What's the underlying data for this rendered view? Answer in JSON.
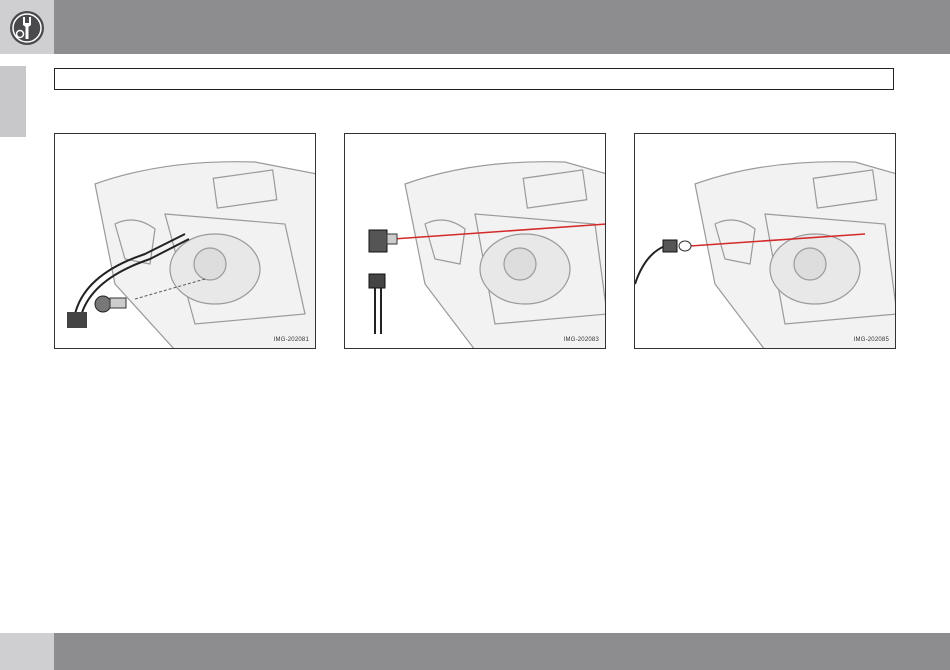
{
  "header": {
    "icon": "wrench-gear-icon",
    "color": "#8d8d90"
  },
  "section": {
    "title": ""
  },
  "figures": [
    {
      "id": "IMG-202081",
      "content": "headlight-bulb-removal-with-holder"
    },
    {
      "id": "IMG-202083",
      "content": "headlight-bulb-holder-connector"
    },
    {
      "id": "IMG-202085",
      "content": "headlight-small-bulb-replacement"
    }
  ],
  "footer": {
    "page_number": ""
  },
  "colors": {
    "bar": "#8d8d90",
    "tile": "#cfcfd1",
    "tab": "#c8c8ca",
    "line_red": "#d42a2a"
  }
}
